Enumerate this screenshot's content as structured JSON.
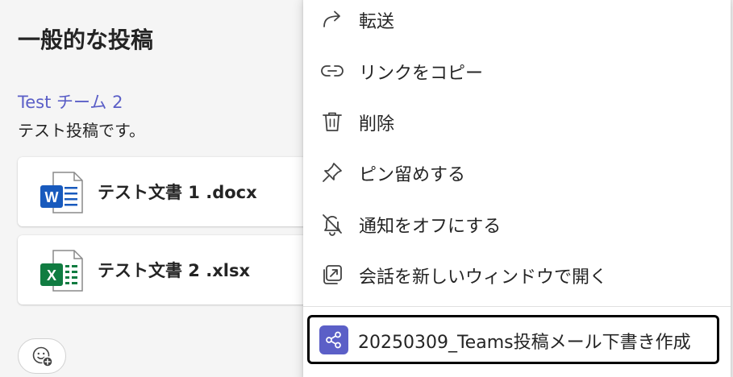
{
  "post": {
    "title": "一般的な投稿",
    "channel_link": "Test チーム 2",
    "text": "テスト投稿です。",
    "attachments": [
      {
        "name": "テスト文書 1 .docx",
        "icon": "word-file-icon"
      },
      {
        "name": "テスト文書 2 .xlsx",
        "icon": "excel-file-icon"
      }
    ],
    "word_icon_letter": "W",
    "excel_icon_letter": "X"
  },
  "context_menu": {
    "items": [
      {
        "label": "転送",
        "icon": "forward-icon"
      },
      {
        "label": "リンクをコピー",
        "icon": "link-icon"
      },
      {
        "label": "削除",
        "icon": "trash-icon"
      },
      {
        "label": "ピン留めする",
        "icon": "pin-icon"
      },
      {
        "label": "通知をオフにする",
        "icon": "bell-off-icon"
      },
      {
        "label": "会話を新しいウィンドウで開く",
        "icon": "popout-icon"
      }
    ],
    "app_action": {
      "label": "20250309_Teams投稿メール下書き作成",
      "icon": "workflow-share-icon"
    }
  },
  "colors": {
    "accent": "#5b5fc7",
    "word_blue": "#185abd",
    "excel_green": "#107c41",
    "focus_border": "#000000"
  }
}
